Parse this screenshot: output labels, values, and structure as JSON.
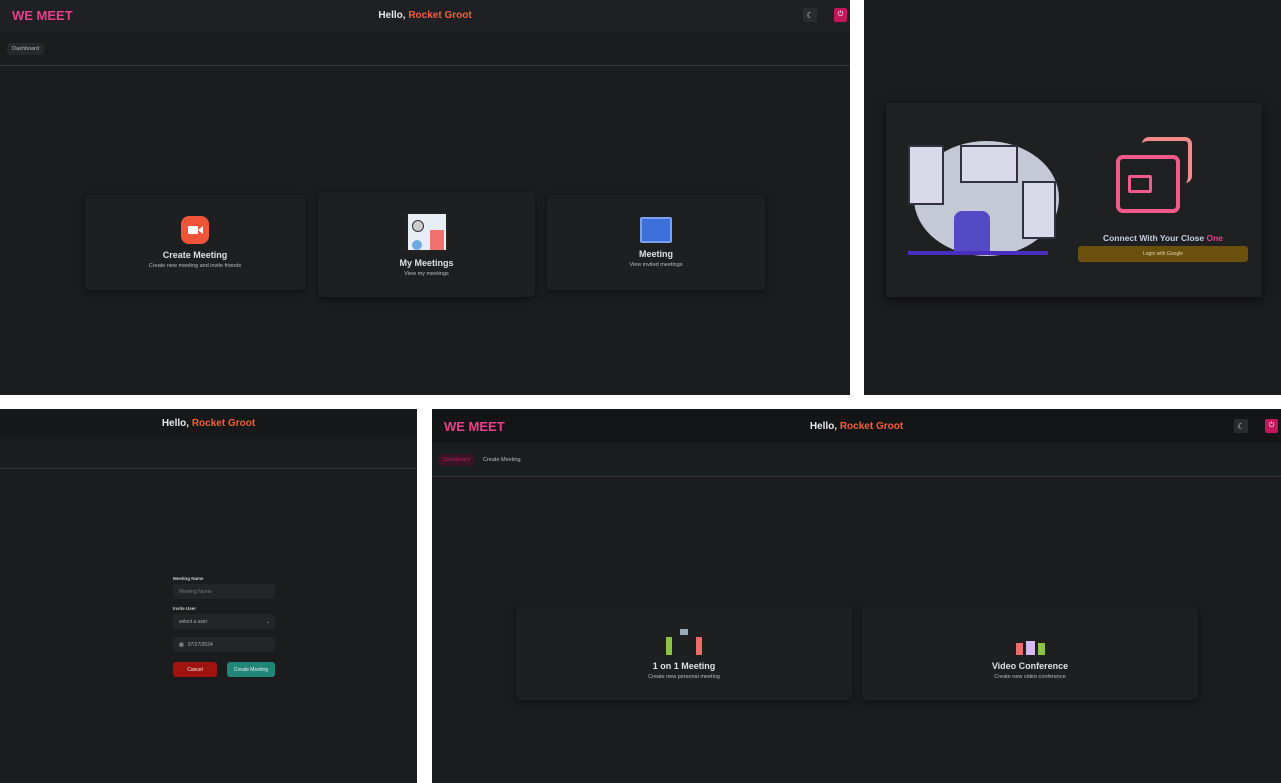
{
  "app": {
    "brand": "WE MEET",
    "greeting": "Hello,",
    "user": "Rocket Groot"
  },
  "dashboard": {
    "breadcrumb": [
      "Dashboard"
    ],
    "cards": [
      {
        "title": "Create Meeting",
        "desc": "Create new meeting and invite friends",
        "icon": "video-camera-icon"
      },
      {
        "title": "My Meetings",
        "desc": "View my meetings",
        "icon": "dashboard-report-icon"
      },
      {
        "title": "Meeting",
        "desc": "View invited meetings",
        "icon": "monitor-chart-icon"
      }
    ]
  },
  "login": {
    "tagline": "Connect With Your Close",
    "tagline_accent": "One",
    "button": "Login with Google"
  },
  "create_form": {
    "meeting_name_label": "Meeting Name",
    "meeting_name_placeholder": "Meeting Name",
    "invite_label": "Invite User",
    "invite_value": "select a user",
    "date_value": "07/27/2024",
    "cancel": "Cancel",
    "submit": "Create Meeting"
  },
  "create_meeting": {
    "breadcrumb": [
      "Dashboard",
      "Create Meeting"
    ],
    "cards": [
      {
        "title": "1 on 1 Meeting",
        "desc": "Create new personal meeting",
        "icon": "two-people-chat-icon"
      },
      {
        "title": "Video Conference",
        "desc": "Create new video conference",
        "icon": "group-conference-icon"
      }
    ]
  },
  "colors": {
    "brand": "#e83e8c",
    "user": "#f0603a",
    "login_button": "#6b4f0c",
    "cancel": "#a0140f",
    "submit": "#21867a"
  }
}
